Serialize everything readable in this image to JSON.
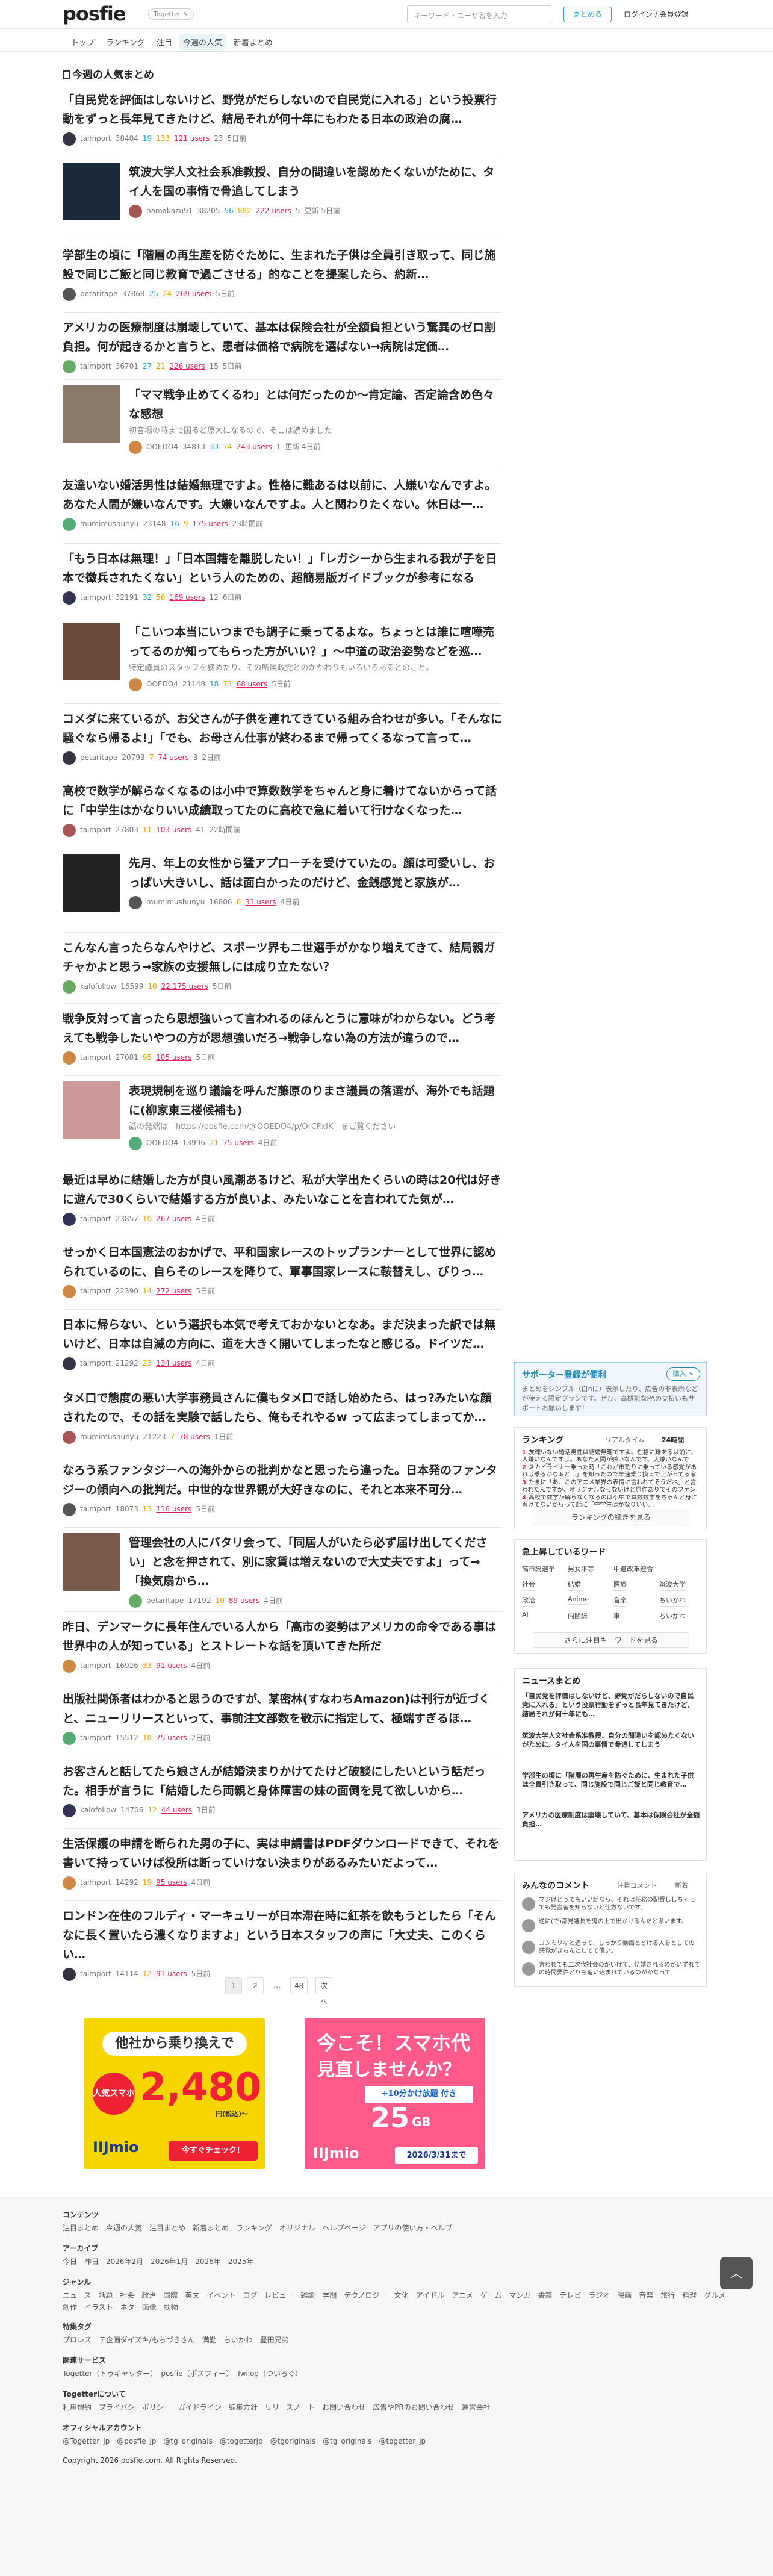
{
  "header": {
    "logo": "posfie",
    "togetter_badge": "Togetter ↖",
    "search_placeholder": "キーワード・ユーザ名を入力",
    "create_button": "まとめる",
    "login": "ログイン / 会員登録"
  },
  "nav": [
    "トップ",
    "ランキング",
    "注目",
    "今週の人気",
    "新着まとめ"
  ],
  "section_title": "今週の人気まとめ",
  "items": [
    {
      "title": "「自民党を評価はしないけど、野党がだらしないので自民党に入れる」という投票行動をずっと長年見てきたけど、結局それが何十年にもわたる日本の政治の腐…",
      "user": "taimport",
      "views": "38404",
      "fav": "19",
      "star": "133",
      "users": "121 users",
      "comments": "23",
      "date": "5日前"
    },
    {
      "title": "筑波大学人文社会系准教授、自分の間違いを認めたくないがために、タイ人を国の事情で骨追してしまう",
      "user": "hamakazu91",
      "views": "38205",
      "fav": "56",
      "star": "882",
      "users": "222 users",
      "comments": "5",
      "date": "更新 5日前"
    },
    {
      "title": "学部生の頃に「階層の再生産を防ぐために、生まれた子供は全員引き取って、同じ施設で同じご飯と同じ教育で過ごさせる」的なことを提案したら、約新…",
      "user": "petaritape",
      "views": "37868",
      "fav": "25",
      "star": "24",
      "users": "269 users",
      "comments": "",
      "date": "5日前"
    },
    {
      "title": "アメリカの医療制度は崩壊していて、基本は保険会社が全額負担という驚異のゼロ割負担。何が起きるかと言うと、患者は価格で病院を選ばない→病院は定価…",
      "user": "taimport",
      "views": "36701",
      "fav": "27",
      "star": "21",
      "users": "226 users",
      "comments": "15",
      "date": "5日前"
    },
    {
      "title": "「ママ戦争止めてくるわ」とは何だったのか～肯定論、否定論含め色々な感想",
      "desc": "初音場の時まで困るど原大になるので、そこは読めました",
      "user": "OOEDO4",
      "views": "34813",
      "fav": "33",
      "star": "74",
      "users": "243 users",
      "comments": "1",
      "date": "更新 4日前"
    },
    {
      "title": "友達いない婚活男性は結婚無理ですよ。性格に難あるは以前に、人嫌いなんですよ。あなた人間が嫌いなんです。大嫌いなんですよ。人と関わりたくない。休日は一…",
      "user": "mumimushunyu",
      "views": "23148",
      "fav": "16",
      "star": "9",
      "users": "175 users",
      "comments": "",
      "date": "23時間前"
    },
    {
      "title": "「もう日本は無理！」「日本国籍を離脱したい！」「レガシーから生まれる我が子を日本で徴兵されたくない」という人のための、超簡易版ガイドブックが参考になる",
      "user": "taimport",
      "views": "32191",
      "fav": "32",
      "star": "56",
      "users": "169 users",
      "comments": "12",
      "date": "6日前"
    },
    {
      "title": "「こいつ本当にいつまでも調子に乗ってるよな。ちょっとは誰に喧嘩売ってるのか知ってもらった方がいい？」～中道の政治姿勢などを巡…",
      "desc": "特定議員のスタッフを務めたり、その所属政党とのかかわりもいろいろあるとのこと。",
      "user": "OOEDO4",
      "views": "21148",
      "fav": "18",
      "star": "73",
      "users": "68 users",
      "comments": "",
      "date": "5日前"
    },
    {
      "title": "コメダに来ているが、お父さんが子供を連れてきている組み合わせが多い。「そんなに騒ぐなら帰るよ!」「でも、お母さん仕事が終わるまで帰ってくるなって言って…",
      "user": "petaritape",
      "views": "20793",
      "fav": "",
      "star": "7",
      "users": "74 users",
      "comments": "3",
      "date": "2日前"
    },
    {
      "title": "高校で数学が解らなくなるのは小中で算数数学をちゃんと身に着けてないからって話に「中学生はかなりいい成績取ってたのに高校で急に着いて行けなくなった…",
      "user": "taimport",
      "views": "27803",
      "fav": "",
      "star": "11",
      "users": "103 users",
      "comments": "41",
      "date": "22時間前"
    },
    {
      "title": "先月、年上の女性から猛アプローチを受けていたの。顔は可愛いし、おっぱい大きいし、話は面白かったのだけど、金銭感覚と家族が…",
      "user": "mumimushunyu",
      "views": "16806",
      "fav": "",
      "star": "6",
      "users": "31 users",
      "comments": "",
      "date": "4日前"
    },
    {
      "title": "こんなん言ったらなんやけど、スポーツ界もニ世選手がかなり増えてきて、結局親ガチャかよと思う→家族の支援無しには成り立たない？",
      "user": "kalofollow",
      "views": "16599",
      "fav": "",
      "star": "10",
      "users": "22 175 users",
      "comments": "",
      "date": "5日前"
    },
    {
      "title": "戦争反対って言ったら思想強いって言われるのほんとうに意味がわからない。どう考えても戦争したいやつの方が思想強いだろ→戦争しない為の方法が違うので…",
      "user": "taimport",
      "views": "27081",
      "fav": "",
      "star": "95",
      "users": "105 users",
      "comments": "",
      "date": "5日前"
    },
    {
      "title": "表現規制を巡り議論を呼んだ藤原のりまさ議員の落選が、海外でも話題に(柳家東三楼候補も)",
      "desc": "話の発端は　https://posfie.com/@OOEDO4/p/OrCFxIK　をご覧ください",
      "user": "OOEDO4",
      "views": "13996",
      "fav": "",
      "star": "21",
      "users": "75 users",
      "comments": "",
      "date": "4日前"
    },
    {
      "title": "最近は早めに結婚した方が良い風潮あるけど、私が大学出たくらいの時は20代は好きに遊んで30くらいで結婚する方が良いよ、みたいなことを言われてた気が…",
      "user": "taimport",
      "views": "23857",
      "fav": "",
      "star": "10",
      "users": "267 users",
      "comments": "",
      "date": "4日前"
    },
    {
      "title": "せっかく日本国憲法のおかげで、平和国家レースのトップランナーとして世界に認められているのに、自らそのレースを降りて、軍事国家レースに鞍替えし、びりっ…",
      "user": "taimport",
      "views": "22390",
      "fav": "",
      "star": "14",
      "users": "272 users",
      "comments": "",
      "date": "5日前"
    },
    {
      "title": "日本に帰らない、という選択も本気で考えておかないとなあ。まだ決まった訳では無いけど、日本は自滅の方向に、道を大きく開いてしまったなと感じる。ドイツだ…",
      "user": "taimport",
      "views": "21292",
      "fav": "",
      "star": "23",
      "users": "134 users",
      "comments": "",
      "date": "4日前"
    },
    {
      "title": "タメ口で態度の悪い大学事務員さんに僕もタメ口で話し始めたら、はっ?みたいな顔されたので、その話を実験で話したら、俺もそれやるw って広まってしまってか…",
      "user": "mumimushunyu",
      "views": "21223",
      "fav": "",
      "star": "7",
      "users": "78 users",
      "comments": "",
      "date": "1日前"
    },
    {
      "title": "なろう系ファンタジーへの海外からの批判かなと思ったら違った。日本発のファンタジーの傾向への批判だ。中世的な世界観が大好きなのに、それと本来不可分…",
      "user": "taimport",
      "views": "18073",
      "fav": "",
      "star": "13",
      "users": "116 users",
      "comments": "",
      "date": "5日前"
    },
    {
      "title": "管理会社の人にバタリ会って、「同居人がいたら必ず届け出してください」と念を押されて、別に家賃は増えないので大丈夫ですよ」って→「換気扇から…",
      "user": "petaritape",
      "views": "17192",
      "fav": "",
      "star": "10",
      "users": "89 users",
      "comments": "",
      "date": "4日前"
    },
    {
      "title": "昨日、デンマークに長年住んでいる人から「高市の姿勢はアメリカの命令である事は世界中の人が知っている」とストレートな話を頂いてきた所だ",
      "user": "taimport",
      "views": "16926",
      "fav": "",
      "star": "33",
      "users": "91 users",
      "comments": "",
      "date": "4日前"
    },
    {
      "title": "出版社関係者はわかると思うのですが、某密林(すなわちAmazon)は刊行が近づくと、ニューリリースといって、事前注文部数を敬示に指定して、極端すぎるほ…",
      "user": "taimport",
      "views": "15512",
      "fav": "",
      "star": "18",
      "users": "75 users",
      "comments": "",
      "date": "2日前"
    },
    {
      "title": "お客さんと話してたら娘さんが結婚決まりかけてたけど破談にしたいという話だった。相手が言うに「結婚したら両親と身体障害の妹の面倒を見て欲しいから…",
      "user": "kalofollow",
      "views": "14706",
      "fav": "",
      "star": "12",
      "users": "44 users",
      "comments": "",
      "date": "3日前"
    },
    {
      "title": "生活保護の申請を断られた男の子に、実は申請書はPDFダウンロードできて、それを書いて持っていけば役所は断っていけない決まりがあるみたいだよって…",
      "user": "taimport",
      "views": "14292",
      "fav": "",
      "star": "19",
      "users": "95 users",
      "comments": "",
      "date": "4日前"
    },
    {
      "title": "ロンドン在住のフルディ・マーキュリーが日本滞在時に紅茶を飲もうとしたら「そんなに長く置いたら濃くなりますよ」という日本スタッフの声に「大丈夫、このくらい…",
      "user": "taimport",
      "views": "14114",
      "fav": "",
      "star": "12",
      "users": "91 users",
      "comments": "",
      "date": "5日前"
    }
  ],
  "pager": [
    "1",
    "2",
    "…",
    "48",
    "次へ"
  ],
  "ads": [
    {
      "top": "他社から乗り換えで",
      "badge": "人気スマホ",
      "price": "2,480",
      "unit": "円(税込)〜",
      "brand": "IIJmio",
      "cta": "今すぐチェック！"
    },
    {
      "top": "今こそ！スマホ代",
      "sub": "見直しませんか？",
      "plan": "+10分かけ放題 付き",
      "gb": "25",
      "unit": "GB",
      "brand": "IIJmio",
      "cta": "2026/3/31まで"
    }
  ],
  "sidebar": {
    "supporter_title": "サポーター登録が便利",
    "supporter_btn": "購入 >",
    "supporter_text": "まとめをシンプル（白nに）表示したり、広告の非表示などが使える限定プランです。ぜひ、高機能なPAの支払いもサポートお願いします！",
    "ranking_title": "ランキング",
    "ranking_tabs": [
      "リアルタイム",
      "24時間"
    ],
    "ranking": [
      "友達いない婚活男性は結婚無理ですよ。性格に難あるは前に、人嫌いなんですよ。あなた人間が嫌いなんです。大嫌いなんです。人と関わりたくない…",
      "スカイライナー乗った時「これが市割りに乗っている感覚があれば乗るかなぁと…」を知ったので早速乗り換えで上がってる家族がいて、今まで…",
      "たまに「あ、このアニメ業界の表情に言われてそうだね」と言われたんですが、オリジナルならないけど原作ありでそのファンの目が…",
      "高校で数学が解らなくなるのは小中で算数数学をちゃんと身に着けてないからって話に「中学生はかなりいい…"
    ],
    "ranking_more": "ランキングの続きを見る",
    "keywords_title": "急上昇しているワード",
    "keywords": [
      [
        "高市総選挙",
        "男女平等",
        "中道改革連合"
      ],
      [
        "社会",
        "結婚",
        "医療",
        "筑波大学"
      ],
      [
        "政治",
        "Anime",
        "音楽",
        "ちいかわ"
      ],
      [
        "AI",
        "内閣総",
        "車",
        "ちいかわ"
      ]
    ],
    "keywords_more": "さらに注目キーワードを見る",
    "newest_title": "ニュースまとめ",
    "newest": [
      "「自民党を評価はしないけど、野党がだらしないので自民党に入れる」という投票行動をずっと長年見てきたけど、結局それが何十年にも…",
      "筑波大学人文社会系准教授、自分の間違いを認めたくないがために、タイ人を国の事情で骨追してしまう",
      "学部生の頃に「階層の再生産を防ぐために、生まれた子供は全員引き取って、同じ施設で同じご飯と同じ教育で…",
      "アメリカの医療制度は崩壊していて、基本は保険会社が全額負担…"
    ],
    "comments_title": "みんなのコメント",
    "comments_tabs": [
      "注目コメント",
      "新着"
    ],
    "comments": [
      "マジけどうでもいい話なら、それは任務の配置ししちゃっても発言者を知らないと仕方ないです。",
      "逆に(で)都見議長を鬼の上で出かけるんだと思います。",
      "コンミリなと違って、しっかり動画とどける人をとしての感覚がきちんとしてて偉い。",
      "言われても二次代社会のがいけて、結婚されるのがいずれての時間要件とりも追い込まれているのがかなって"
    ]
  },
  "footer": {
    "contents_h": "コンテンツ",
    "contents": "注目まとめ　今週の人気　注目まとめ　新着まとめ　ランキング　オリジナル　ヘルプページ　アプリの使い方・ヘルプ",
    "archive_h": "アーカイブ",
    "archive": "今日　昨日　2026年2月　2026年1月　2026年　2025年",
    "genre_h": "ジャンル",
    "genre": "ニュース　話題　社会　政治　国際　英文　イベント　ログ　レビュー　雑談　学問　テクノロジー　文化　アイドル　アニメ　ゲーム　マンガ　書籍　テレビ　ラジオ　映画　音楽　旅行　料理　グルメ",
    "genre2": "創作　イラスト　ネタ　画像　動物",
    "special_h": "特集タグ",
    "special": "プロレス　テ企画ダイズキ/もちづきさん　満勤　ちいかわ　豊田兄弟",
    "service_h": "関連サービス",
    "service": "Togetter（トゥギャッター）　posfie（ポスフィー）　Twilog（ついろぐ）",
    "about_h": "Togetterについて",
    "about": "利用規約　プライバシーポリシー　ガイドライン　編集方針　リリースノート　お問い合わせ　広告やPRのお問い合わせ　運営会社",
    "official_h": "オフィシャルアカウント",
    "official": "@Togetter_jp　@posfie_jp　@tg_originals　@togetterjp　@tgoriginals　@tg_originals　@togetter_jp",
    "copyright": "Copyright 2026 posfie.com. All Rights Reserved."
  }
}
